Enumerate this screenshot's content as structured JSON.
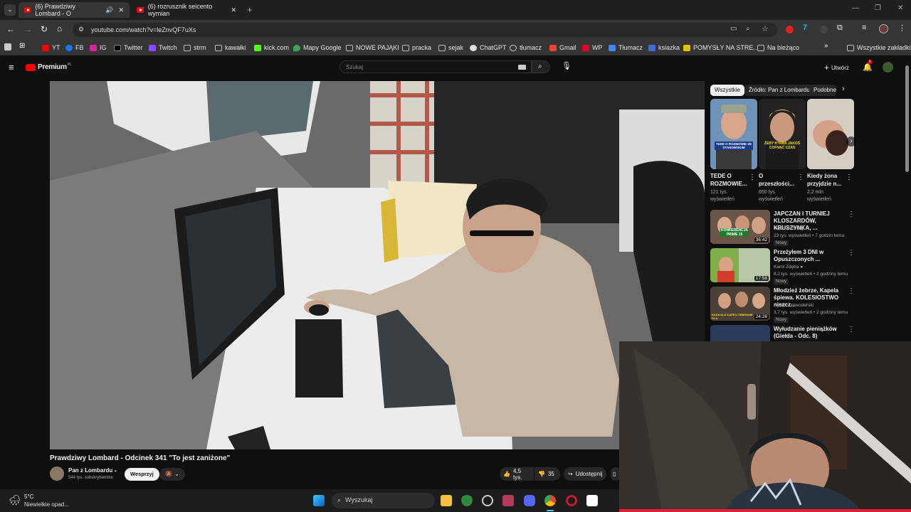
{
  "tabs": [
    {
      "title": "(6) Prawdziwy Lombard - O",
      "active": true
    },
    {
      "title": "(6) rozrusznik seicento wymian",
      "active": false
    }
  ],
  "address": {
    "url": "youtube.com/watch?v=leZnvQF7uXs"
  },
  "bookmarks": [
    {
      "label": "YT",
      "icon": "youtube-icon"
    },
    {
      "label": "FB",
      "icon": "facebook-icon"
    },
    {
      "label": "IG",
      "icon": "instagram-icon"
    },
    {
      "label": "Twitter",
      "icon": "x-icon"
    },
    {
      "label": "Twitch",
      "icon": "twitch-icon"
    },
    {
      "label": "strm",
      "icon": "folder-icon"
    },
    {
      "label": "kawałki",
      "icon": "folder-icon"
    },
    {
      "label": "kick.com",
      "icon": "kick-icon"
    },
    {
      "label": "Mapy Google",
      "icon": "maps-icon"
    },
    {
      "label": "NOWE PAJĄKI",
      "icon": "folder-icon"
    },
    {
      "label": "pracka",
      "icon": "folder-icon"
    },
    {
      "label": "sejak",
      "icon": "folder-icon"
    },
    {
      "label": "ChatGPT",
      "icon": "chatgpt-icon"
    },
    {
      "label": "tłumacz",
      "icon": "globe-icon"
    },
    {
      "label": "Gmail",
      "icon": "gmail-icon"
    },
    {
      "label": "WP",
      "icon": "wp-icon"
    },
    {
      "label": "Tłumacz",
      "icon": "translate-icon"
    },
    {
      "label": "ksiazka",
      "icon": "folder-icon"
    },
    {
      "label": "POMYSŁY NA STRE...",
      "icon": "folder-icon"
    },
    {
      "label": "Na bieżąco",
      "icon": "folder-icon"
    }
  ],
  "all_bookmarks": "Wszystkie zakładki",
  "youtube": {
    "logo_text": "Premium",
    "logo_superscript": "PL",
    "search_placeholder": "Szukaj",
    "create_label": "Utwórz",
    "notif_count": "6"
  },
  "video": {
    "title": "Prawdziwy Lombard - Odcinek 341 \"To jest zaniżone\"",
    "channel": "Pan z Lombardu",
    "subscribers": "544 tys. subskrybentów",
    "support_label": "Wesprzyj",
    "likes": "4,5 tys.",
    "dislikes": "35",
    "share_label": "Udostępnij"
  },
  "chips": [
    "Wszystkie",
    "Źródło: Pan z Lombardu",
    "Podobne"
  ],
  "shorts": [
    {
      "title": "TEDE O ROZMOWIE...",
      "views": "121 tys. wyświetleń",
      "overlay": "TEDE O ROZMOWIE ZE STANOWSKIM"
    },
    {
      "title": "O przeszłości...",
      "views": "650 tys. wyświetleń",
      "overlay": "ŻEBY K*RWA JAKOŚ COFNĄĆ CZAS"
    },
    {
      "title": "Kiedy żona przyjdzie n...",
      "views": "2,2 mln wyświetleń",
      "overlay": ""
    }
  ],
  "recommended": [
    {
      "title": "JAPCZAN I TURNIEJ KLOSZARDÓW, KRUSZYNKA, ...",
      "channel": "Japczan Shoty",
      "meta": "23 tys. wyświetleń • 7 godzin temu",
      "badge": "Nowy",
      "duration": "36:42",
      "thumb_text": "KONFERENCJA PRIME 15"
    },
    {
      "title": "Przeżyłem 3 DNI w Opuszczonych ...",
      "channel": "Karol Zdęba",
      "meta": "8,2 tys. wyświetleń • 2 godziny temu",
      "badge": "Nowy",
      "duration": "17:58",
      "thumb_text": ""
    },
    {
      "title": "Młodzież żebrze, Kapela śpiewa. KOLESIOSTWO niszcz...",
      "channel": "Rynek Krowoderski",
      "meta": "3,7 tys. wyświetleń • 2 godziny temu",
      "badge": "Nowy",
      "duration": "24:28",
      "thumb_text": "KASA DLA KAPELI ŻEBRANIE DLA"
    },
    {
      "title": "Wyłudzanie pieniążków (Giełda - Odc. 8)",
      "channel": "",
      "meta": "",
      "badge": "",
      "duration": "",
      "thumb_text": ""
    }
  ],
  "taskbar": {
    "weather_temp": "5°C",
    "weather_desc": "Niewielkie opad...",
    "search_label": "Wyszukaj"
  },
  "colors": {
    "yt_red": "#ff0000",
    "bg": "#0f0f0f",
    "chip": "#272727"
  }
}
